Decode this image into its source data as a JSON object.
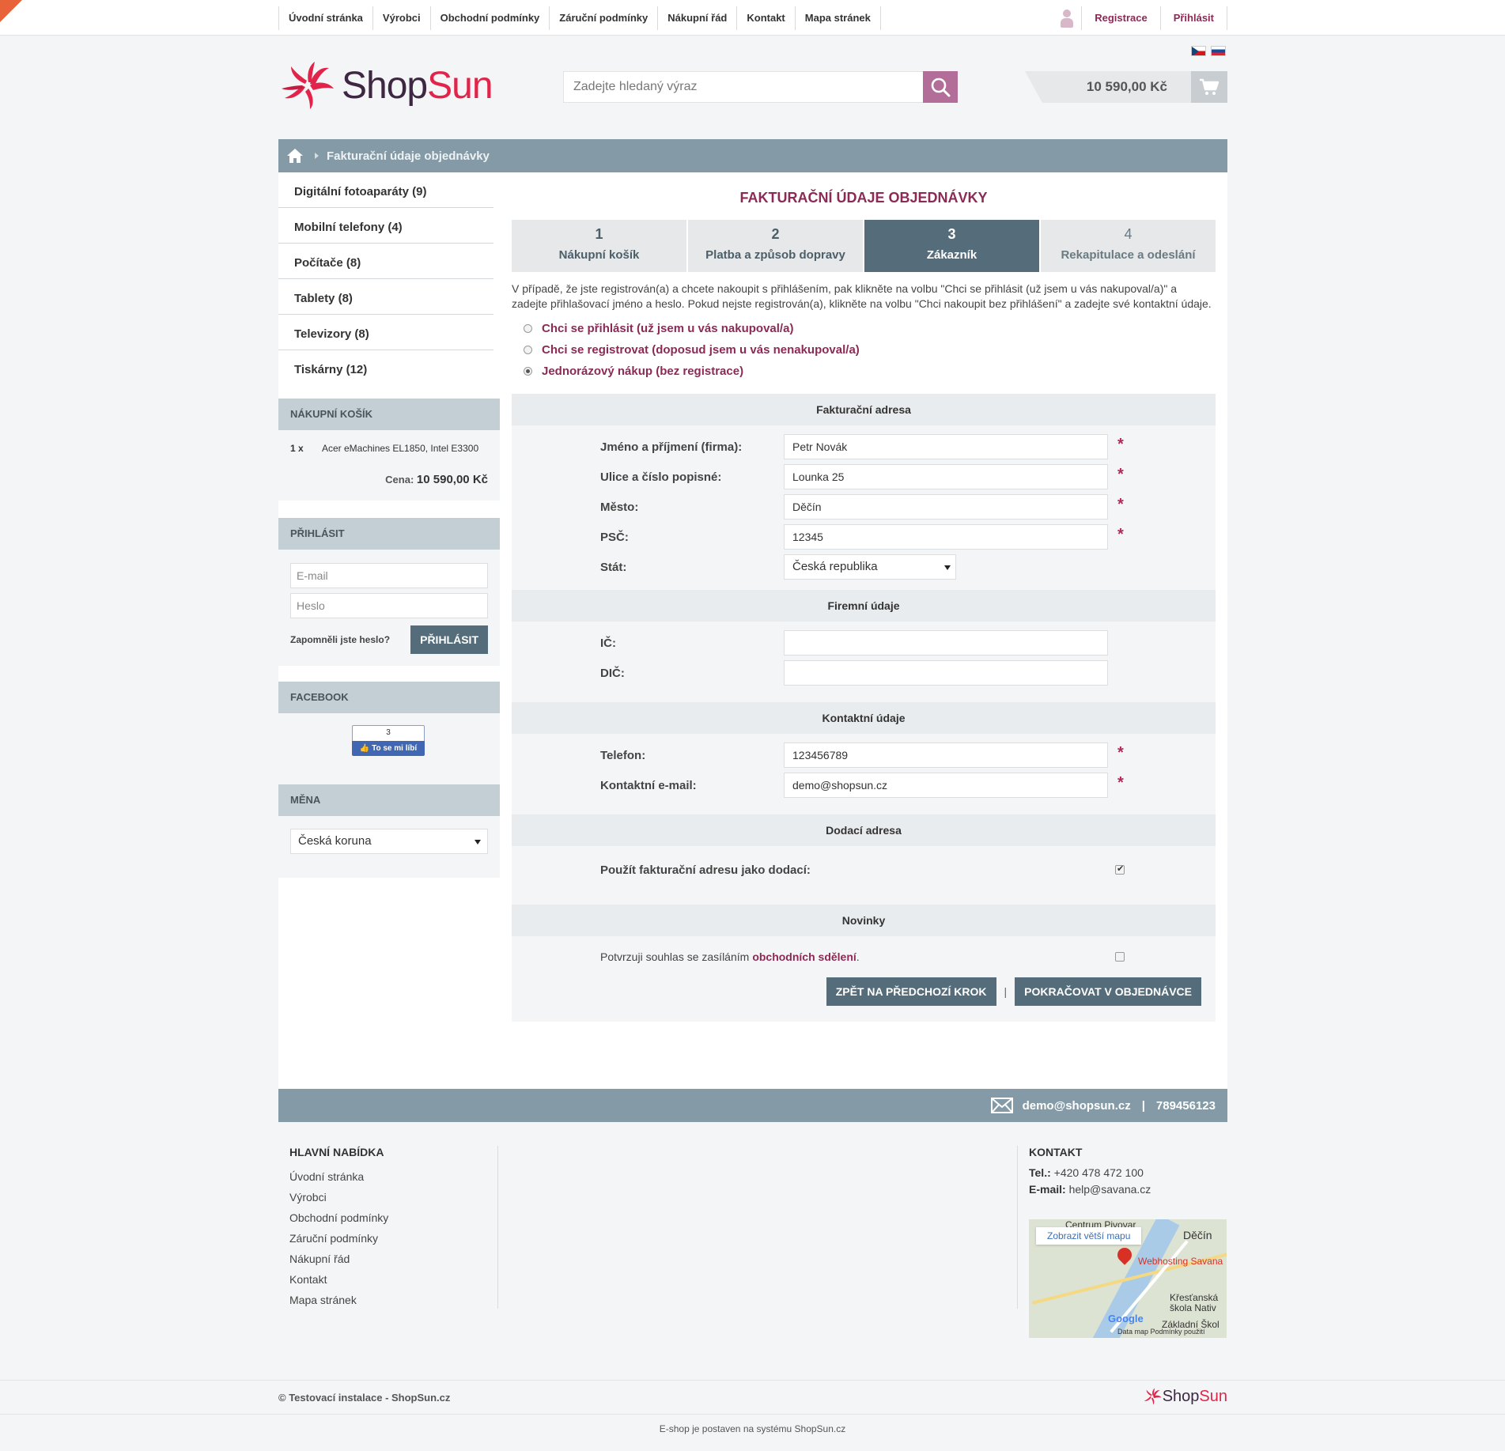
{
  "topnav": {
    "items": [
      "Úvodní stránka",
      "Výrobci",
      "Obchodní podmínky",
      "Záruční podmínky",
      "Nákupní řád",
      "Kontakt",
      "Mapa stránek"
    ],
    "register": "Registrace",
    "login": "Přihlásit"
  },
  "header": {
    "logo_shop": "Shop",
    "logo_sun": "Sun",
    "search_placeholder": "Zadejte hledaný výraz",
    "cart_total": "10 590,00 Kč"
  },
  "breadcrumb": {
    "current": "Fakturační údaje objednávky"
  },
  "sidebar": {
    "categories": [
      "Digitální fotoaparáty (9)",
      "Mobilní telefony (4)",
      "Počítače (8)",
      "Tablety (8)",
      "Televizory (8)",
      "Tiskárny (12)"
    ],
    "cart": {
      "title": "Nákupní košík",
      "qty": "1 x",
      "product": "Acer eMachines EL1850, Intel E3300",
      "price_label": "Cena:",
      "price_value": "10 590,00 Kč"
    },
    "login": {
      "title": "Přihlásit",
      "email_placeholder": "E-mail",
      "password_placeholder": "Heslo",
      "forgot": "Zapomněli jste heslo?",
      "button": "Přihlásit"
    },
    "facebook": {
      "title": "Facebook",
      "count": "3",
      "like": "To se mi líbí"
    },
    "currency": {
      "title": "Měna",
      "selected": "Česká koruna"
    }
  },
  "content": {
    "title": "Fakturační údaje objednávky",
    "steps": [
      {
        "num": "1",
        "label": "Nákupní košík"
      },
      {
        "num": "2",
        "label": "Platba a způsob dopravy"
      },
      {
        "num": "3",
        "label": "Zákazník"
      },
      {
        "num": "4",
        "label": "Rekapitulace a odeslání"
      }
    ],
    "active_step": 3,
    "intro": "V případě, že jste registrován(a) a chcete nakoupit s přihlášením, pak klikněte na volbu \"Chci se přihlásit (už jsem u vás nakupoval/a)\" a zadejte přihlašovací jméno a heslo. Pokud nejste registrován(a), klikněte na volbu \"Chci nakoupit bez přihlášení\" a zadejte své kontaktní údaje.",
    "options": [
      "Chci se přihlásit (už jsem u vás nakupoval/a)",
      "Chci se registrovat (doposud jsem u vás nenakupoval/a)",
      "Jednorázový nákup (bez registrace)"
    ],
    "selected_option": 3,
    "billing": {
      "title": "Fakturační adresa",
      "name_label": "Jméno a příjmení (firma):",
      "name_value": "Petr Novák",
      "street_label": "Ulice a číslo popisné:",
      "street_value": "Lounka 25",
      "city_label": "Město:",
      "city_value": "Děčín",
      "zip_label": "PSČ:",
      "zip_value": "12345",
      "country_label": "Stát:",
      "country_value": "Česká republika",
      "required_mark": "*"
    },
    "company": {
      "title": "Firemní údaje",
      "ic_label": "IČ:",
      "ic_value": "",
      "dic_label": "DIČ:",
      "dic_value": ""
    },
    "contact": {
      "title": "Kontaktní údaje",
      "phone_label": "Telefon:",
      "phone_value": "123456789",
      "email_label": "Kontaktní e-mail:",
      "email_value": "demo@shopsun.cz"
    },
    "delivery": {
      "title": "Dodací adresa",
      "same_label": "Použít fakturační adresu jako dodací:",
      "same_checked": true
    },
    "news": {
      "title": "Novinky",
      "consent_text": "Potvrzuji souhlas se zasíláním",
      "consent_link": "obchodních sdělení",
      "consent_end": ".",
      "checked": false
    },
    "buttons": {
      "back": "Zpět na předchozí krok",
      "separator": "|",
      "continue": "Pokračovat v objednávce"
    }
  },
  "contactbar": {
    "email": "demo@shopsun.cz",
    "separator": "|",
    "phone": "789456123"
  },
  "footer": {
    "main_title": "Hlavní nabídka",
    "main_links": [
      "Úvodní stránka",
      "Výrobci",
      "Obchodní podmínky",
      "Záruční podmínky",
      "Nákupní řád",
      "Kontakt",
      "Mapa stránek"
    ],
    "contact_title": "Kontakt",
    "tel_label": "Tel.:",
    "tel_value": "+420 478 472 100",
    "email_label": "E-mail:",
    "email_value": "help@savana.cz",
    "map": {
      "button": "Zobrazit větší mapu",
      "label_1": "Centrum Pivovar",
      "label_2": "Děčín",
      "label_3": "Webhosting Savana",
      "label_4": "Křesťanská",
      "label_5": "škola Nativ",
      "label_6": "Základní Škol",
      "google": "Google",
      "terms": "Data map   Podmínky použití"
    }
  },
  "bottom": {
    "copyright": "© Testovací instalace - ShopSun.cz",
    "logo_shop": "Shop",
    "logo_sun": "Sun",
    "built_with": "E-shop je postaven na systému ShopSun.cz"
  },
  "colors": {
    "accent": "#8a2a55",
    "bar": "#849ba7",
    "button": "#556d7b",
    "search_button": "#b26e98",
    "logo_red": "#e2244a"
  }
}
